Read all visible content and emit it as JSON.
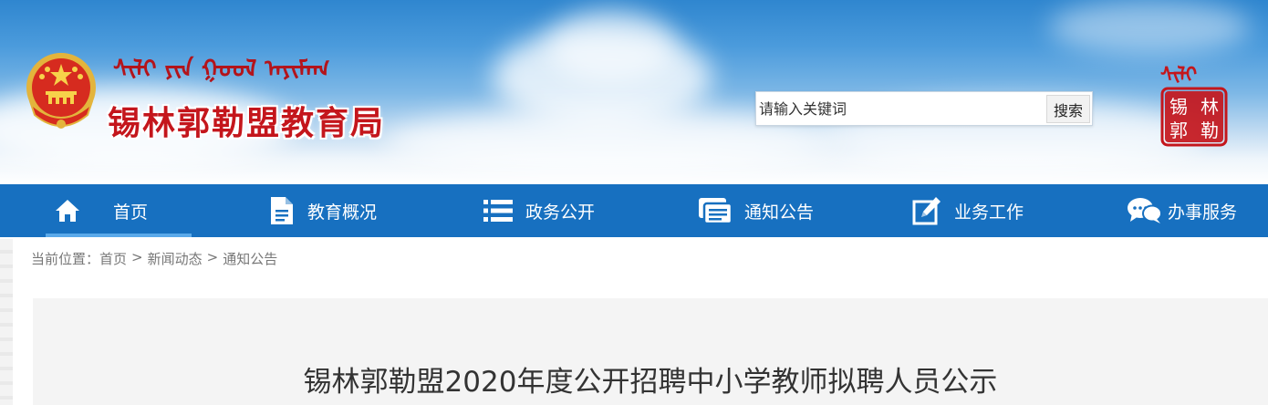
{
  "header": {
    "mongolian_title": "ᠰᠢᠯᠢ ᠶᠢᠨ ᠭᠣᠣᠯ ᠠᠶᠢᠮᠠᠭ",
    "site_title": "锡林郭勒盟教育局",
    "emblem_icon": "national-emblem-icon",
    "search": {
      "placeholder": "请输入关键词",
      "button_label": "搜索"
    },
    "seal": {
      "mongolian": "ᠰᠢᠯᠢ",
      "chars": [
        "锡",
        "林",
        "郭",
        "勒"
      ],
      "icon": "red-seal-icon"
    }
  },
  "nav": {
    "items": [
      {
        "label": "首页",
        "icon": "home-icon",
        "active": true
      },
      {
        "label": "教育概况",
        "icon": "document-icon",
        "active": false
      },
      {
        "label": "政务公开",
        "icon": "list-icon",
        "active": false
      },
      {
        "label": "通知公告",
        "icon": "message-window-icon",
        "active": false
      },
      {
        "label": "业务工作",
        "icon": "edit-icon",
        "active": false
      },
      {
        "label": "办事服务",
        "icon": "chat-bubbles-icon",
        "active": false
      }
    ]
  },
  "breadcrumb": {
    "prefix": "当前位置：",
    "items": [
      "首页",
      "新闻动态",
      "通知公告"
    ],
    "separator": ">"
  },
  "article": {
    "title": "锡林郭勒盟2020年度公开招聘中小学教师拟聘人员公示"
  },
  "colors": {
    "nav_bg": "#1770c0",
    "title_red": "#c4161c",
    "panel_bg": "#f4f4f4"
  }
}
